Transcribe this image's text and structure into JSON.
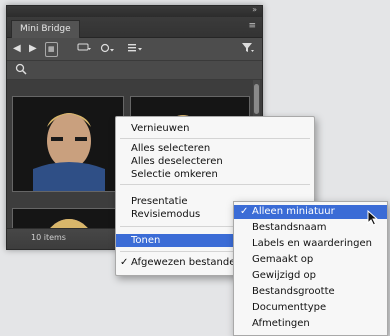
{
  "panel": {
    "tab_label": "Mini Bridge",
    "collapse_glyph": "»",
    "panel_menu_glyph": "≡",
    "status_count": "10 items"
  },
  "toolbar": {
    "back_icon": "back-arrow-icon",
    "forward_icon": "forward-arrow-icon",
    "home_icon": "folder-home-icon",
    "tools_icon": "tools-dropdown-icon",
    "view_icon": "view-options-icon",
    "sort_icon": "sort-icon",
    "filter_icon": "filter-funnel-icon",
    "search_icon": "search-icon"
  },
  "context_menu": {
    "items": [
      {
        "label": "Vernieuwen"
      },
      {
        "label": "Alles selecteren"
      },
      {
        "label": "Alles deselecteren"
      },
      {
        "label": "Selectie omkeren"
      },
      {
        "label": "Presentatie"
      },
      {
        "label": "Revisiemodus"
      },
      {
        "label": "Tonen",
        "highlighted": true,
        "has_submenu": true
      },
      {
        "label": "Afgewezen bestanden",
        "checked": true
      }
    ]
  },
  "submenu": {
    "items": [
      {
        "label": "Alleen miniatuur",
        "checked": true,
        "highlighted": true
      },
      {
        "label": "Bestandsnaam"
      },
      {
        "label": "Labels en waarderingen"
      },
      {
        "label": "Gemaakt op"
      },
      {
        "label": "Gewijzigd op"
      },
      {
        "label": "Bestandsgrootte"
      },
      {
        "label": "Documenttype"
      },
      {
        "label": "Afmetingen"
      }
    ]
  },
  "colors": {
    "highlight": "#3b6cd6",
    "panel_bg": "#505050",
    "menu_bg": "#f7f7f7"
  }
}
